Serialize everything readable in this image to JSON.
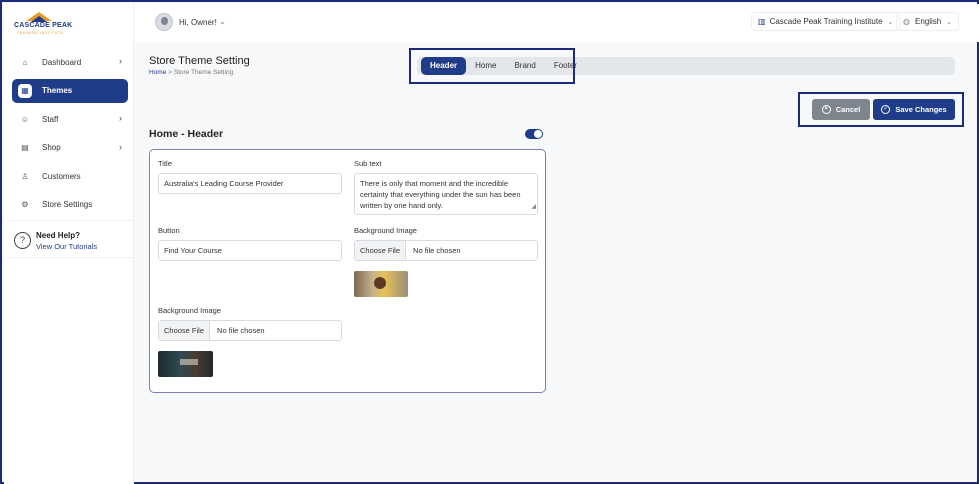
{
  "brand": {
    "name": "CASCADE PEAK",
    "tagline": "TRAINING INSTITUTE"
  },
  "sidebar": {
    "items": [
      {
        "label": "Dashboard",
        "icon": "home-icon",
        "chevron": true,
        "active": false
      },
      {
        "label": "Themes",
        "icon": "themes-icon",
        "chevron": false,
        "active": true
      },
      {
        "label": "Staff",
        "icon": "staff-icon",
        "chevron": true,
        "active": false
      },
      {
        "label": "Shop",
        "icon": "shop-icon",
        "chevron": true,
        "active": false
      },
      {
        "label": "Customers",
        "icon": "user-icon",
        "chevron": false,
        "active": false
      },
      {
        "label": "Store Settings",
        "icon": "settings-icon",
        "chevron": false,
        "active": false
      }
    ],
    "help": {
      "title": "Need Help?",
      "link": "View Our Tutorials"
    }
  },
  "topbar": {
    "greeting": "Hi, Owner!",
    "institute": "Cascade Peak Training Institute",
    "language": "English"
  },
  "page": {
    "title": "Store Theme Setting",
    "breadcrumb": {
      "home": "Home",
      "separator": ">",
      "current": "Store Theme Setting"
    }
  },
  "tabs": [
    {
      "label": "Header",
      "active": true
    },
    {
      "label": "Home",
      "active": false
    },
    {
      "label": "Brand",
      "active": false
    },
    {
      "label": "Footer",
      "active": false
    }
  ],
  "actions": {
    "cancel": "Cancel",
    "save": "Save Changes"
  },
  "section": {
    "title": "Home - Header",
    "enabled": true
  },
  "form": {
    "title_label": "Title",
    "title_value": "Australia's Leading Course Provider",
    "subtext_label": "Sub text",
    "subtext_value": "There is only that moment and the incredible certainty that everything under the sun has been written by one hand only.",
    "button_label": "Button",
    "button_value": "Find Your Course",
    "bg_image_label": "Background Image",
    "choose_file": "Choose File",
    "no_file": "No file chosen",
    "bg_image2_label": "Background Image"
  },
  "colors": {
    "primary": "#1f3c88",
    "accent": "#e39a2b",
    "cancel": "#7e858d"
  }
}
